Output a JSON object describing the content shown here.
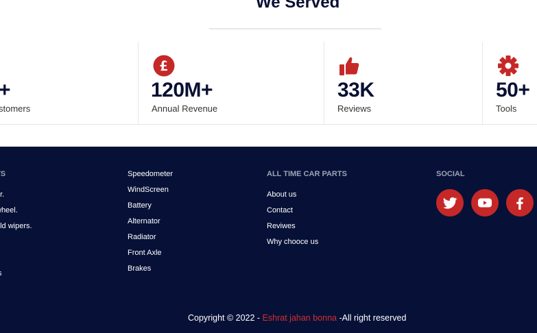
{
  "colors": {
    "accent": "#c62828",
    "footer_bg": "#071137",
    "heading": "#0a1033",
    "muted_heading": "#9aa3b5"
  },
  "section": {
    "title": "We Served"
  },
  "stats": [
    {
      "icon": "customers-icon",
      "value": "+",
      "label": "stomers"
    },
    {
      "icon": "pound-icon",
      "value": "120M+",
      "label": "Annual Revenue"
    },
    {
      "icon": "thumbs-up-icon",
      "value": "33K",
      "label": "Reviews"
    },
    {
      "icon": "gear-icon",
      "value": "50+",
      "label": "Tools"
    }
  ],
  "footer": {
    "columns": [
      {
        "heading": "TS",
        "links": [
          "er.",
          "wheel.",
          "eld wipers.",
          "",
          "",
          "ts"
        ]
      },
      {
        "heading": "",
        "links": [
          "Speedometer",
          "WindScreen",
          "Battery",
          "Alternator",
          "Radiator",
          "Front Axle",
          "Brakes"
        ]
      },
      {
        "heading": "ALL TIME CAR PARTS",
        "links": [
          "About us",
          "Contact",
          "Reviwes",
          "Why chooce us"
        ]
      }
    ],
    "social": {
      "heading": "SOCIAL",
      "icons": [
        "twitter-icon",
        "youtube-icon",
        "facebook-icon"
      ]
    },
    "copyright": {
      "prefix": "Copyright © 2022 - ",
      "author": "Eshrat jahan bonna",
      "suffix": " -All right reserved"
    }
  }
}
